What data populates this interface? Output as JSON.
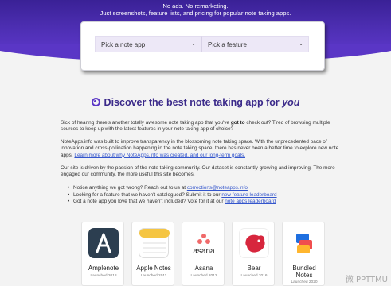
{
  "hero": {
    "line1": "No ads. No remarketing.",
    "line2": "Just screenshots, feature lists, and pricing for popular note taking apps."
  },
  "filters": {
    "app_select": "Pick a note app",
    "feature_select": "Pick a feature"
  },
  "heading": {
    "prefix": "Discover the best note taking app for ",
    "emphasis": "you"
  },
  "intro": {
    "p1_a": "Sick of hearing there's another totally awesome note taking app that you've ",
    "p1_bold": "got to",
    "p1_b": " check out? Tired of browsing multiple sources to keep up with the latest features in your note taking app of choice?",
    "p2_a": "NoteApps.info was built to improve transparency in the blossoming note taking space. With the unprecedented pace of innovation and cross-pollination happening in the note taking space, there has never been a better time to explore new note apps. ",
    "p2_link": "Learn more about why NoteApps.info was created, and our long-term goals.",
    "p3": "Our site is driven by the passion of the note taking community. Our dataset is constantly growing and improving. The more engaged our community, the more useful this site becomes."
  },
  "bullets": [
    {
      "text": "Notice anything we got wrong? Reach out to us at ",
      "link": "corrections@noteapps.info",
      "tail": ""
    },
    {
      "text": "Looking for a feature that we haven't catalogued? Submit it to our ",
      "link": "new feature leaderboard",
      "tail": ""
    },
    {
      "text": "Got a note app you love that we haven't included? Vote for it at our ",
      "link": "note apps leaderboard",
      "tail": ""
    }
  ],
  "apps": [
    {
      "name": "Amplenote",
      "launched": "Launched 2018",
      "icon": "amplenote-icon",
      "color": "#2c3e50"
    },
    {
      "name": "Apple Notes",
      "launched": "Launched 2011",
      "icon": "apple-notes-icon",
      "color": "#f5c542"
    },
    {
      "name": "Asana",
      "launched": "Launched 2012",
      "icon": "asana-icon",
      "color": "#f06a6a"
    },
    {
      "name": "Bear",
      "launched": "Launched 2016",
      "icon": "bear-icon",
      "color": "#d7263d"
    },
    {
      "name": "Bundled\nNotes",
      "launched": "Launched 2020",
      "icon": "bundled-notes-icon",
      "color": "#1e6fe0"
    }
  ],
  "watermark": "微 PPTTMU"
}
